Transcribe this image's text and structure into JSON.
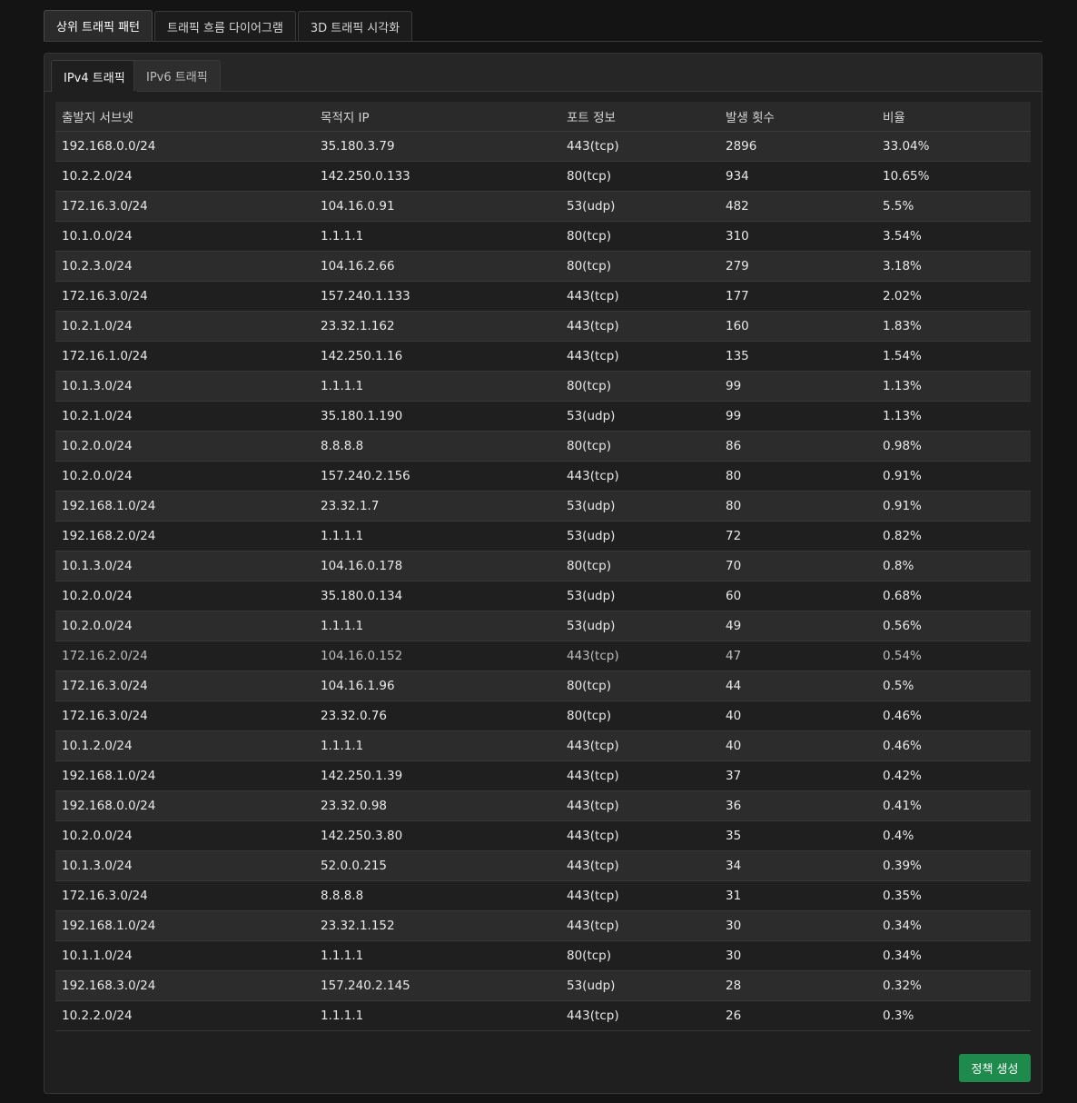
{
  "top_tabs": [
    {
      "label": "상위 트래픽 패턴",
      "active": true
    },
    {
      "label": "트래픽 흐름 다이어그램",
      "active": false
    },
    {
      "label": "3D 트래픽 시각화",
      "active": false
    }
  ],
  "sub_tabs": [
    {
      "label": "IPv4 트래픽",
      "active": true
    },
    {
      "label": "IPv6 트래픽",
      "active": false
    }
  ],
  "table": {
    "headers": [
      "출발지 서브넷",
      "목적지 IP",
      "포트 정보",
      "발생 횟수",
      "비율"
    ],
    "rows": [
      [
        "192.168.0.0/24",
        "35.180.3.79",
        "443(tcp)",
        "2896",
        "33.04%"
      ],
      [
        "10.2.2.0/24",
        "142.250.0.133",
        "80(tcp)",
        "934",
        "10.65%"
      ],
      [
        "172.16.3.0/24",
        "104.16.0.91",
        "53(udp)",
        "482",
        "5.5%"
      ],
      [
        "10.1.0.0/24",
        "1.1.1.1",
        "80(tcp)",
        "310",
        "3.54%"
      ],
      [
        "10.2.3.0/24",
        "104.16.2.66",
        "80(tcp)",
        "279",
        "3.18%"
      ],
      [
        "172.16.3.0/24",
        "157.240.1.133",
        "443(tcp)",
        "177",
        "2.02%"
      ],
      [
        "10.2.1.0/24",
        "23.32.1.162",
        "443(tcp)",
        "160",
        "1.83%"
      ],
      [
        "172.16.1.0/24",
        "142.250.1.16",
        "443(tcp)",
        "135",
        "1.54%"
      ],
      [
        "10.1.3.0/24",
        "1.1.1.1",
        "80(tcp)",
        "99",
        "1.13%"
      ],
      [
        "10.2.1.0/24",
        "35.180.1.190",
        "53(udp)",
        "99",
        "1.13%"
      ],
      [
        "10.2.0.0/24",
        "8.8.8.8",
        "80(tcp)",
        "86",
        "0.98%"
      ],
      [
        "10.2.0.0/24",
        "157.240.2.156",
        "443(tcp)",
        "80",
        "0.91%"
      ],
      [
        "192.168.1.0/24",
        "23.32.1.7",
        "53(udp)",
        "80",
        "0.91%"
      ],
      [
        "192.168.2.0/24",
        "1.1.1.1",
        "53(udp)",
        "72",
        "0.82%"
      ],
      [
        "10.1.3.0/24",
        "104.16.0.178",
        "80(tcp)",
        "70",
        "0.8%"
      ],
      [
        "10.2.0.0/24",
        "35.180.0.134",
        "53(udp)",
        "60",
        "0.68%"
      ],
      [
        "10.2.0.0/24",
        "1.1.1.1",
        "53(udp)",
        "49",
        "0.56%"
      ],
      [
        "172.16.2.0/24",
        "104.16.0.152",
        "443(tcp)",
        "47",
        "0.54%"
      ],
      [
        "172.16.3.0/24",
        "104.16.1.96",
        "80(tcp)",
        "44",
        "0.5%"
      ],
      [
        "172.16.3.0/24",
        "23.32.0.76",
        "80(tcp)",
        "40",
        "0.46%"
      ],
      [
        "10.1.2.0/24",
        "1.1.1.1",
        "443(tcp)",
        "40",
        "0.46%"
      ],
      [
        "192.168.1.0/24",
        "142.250.1.39",
        "443(tcp)",
        "37",
        "0.42%"
      ],
      [
        "192.168.0.0/24",
        "23.32.0.98",
        "443(tcp)",
        "36",
        "0.41%"
      ],
      [
        "10.2.0.0/24",
        "142.250.3.80",
        "443(tcp)",
        "35",
        "0.4%"
      ],
      [
        "10.1.3.0/24",
        "52.0.0.215",
        "443(tcp)",
        "34",
        "0.39%"
      ],
      [
        "172.16.3.0/24",
        "8.8.8.8",
        "443(tcp)",
        "31",
        "0.35%"
      ],
      [
        "192.168.1.0/24",
        "23.32.1.152",
        "443(tcp)",
        "30",
        "0.34%"
      ],
      [
        "10.1.1.0/24",
        "1.1.1.1",
        "80(tcp)",
        "30",
        "0.34%"
      ],
      [
        "192.168.3.0/24",
        "157.240.2.145",
        "53(udp)",
        "28",
        "0.32%"
      ],
      [
        "10.2.2.0/24",
        "1.1.1.1",
        "443(tcp)",
        "26",
        "0.3%"
      ]
    ]
  },
  "actions": {
    "create_policy_label": "정책 생성"
  },
  "colors": {
    "background": "#141414",
    "panel": "#1f1f1f",
    "row_odd": "#2c2c2c",
    "row_even": "#1f1f1f",
    "button": "#1e8a4c"
  }
}
